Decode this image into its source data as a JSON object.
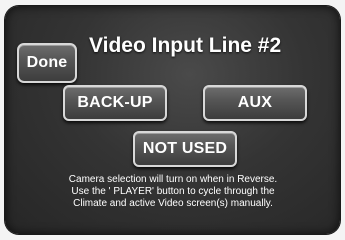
{
  "screen": {
    "title": "Video Input Line #2",
    "done_label": "Done",
    "options": {
      "backup_label": "BACK-UP",
      "aux_label": "AUX",
      "not_used_label": "NOT USED"
    },
    "info_lines": [
      "Camera selection will turn on when in Reverse.",
      "Use the ' PLAYER' button to cycle through the",
      "Climate and active Video screen(s)  manually."
    ]
  }
}
